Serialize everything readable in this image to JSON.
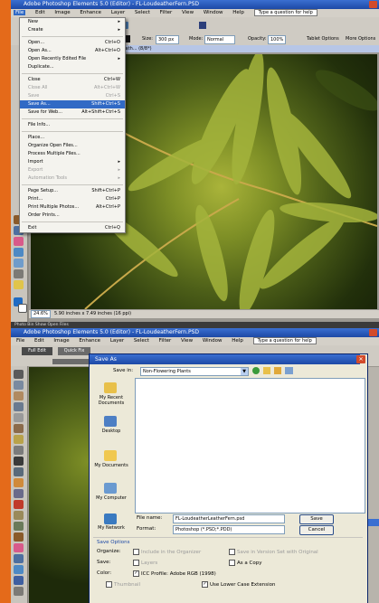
{
  "top": {
    "title": "Adobe Photoshop Elements 5.0 (Editor) - FL-LoudeatherFern.PSD",
    "menu": [
      "File",
      "Edit",
      "Image",
      "Enhance",
      "Layer",
      "Select",
      "Filter",
      "View",
      "Window",
      "Help"
    ],
    "help_box": "Type a question for help",
    "options": {
      "size_label": "Size:",
      "size_value": "300 px",
      "mode_label": "Mode:",
      "mode_value": "Normal",
      "opacity_label": "Opacity:",
      "opacity_value": "100%",
      "tablet_label": "Tablet Options",
      "more_label": "More Options"
    },
    "doc_tab": "FL-Loudeath... (8/8*)",
    "status_zoom": "24.6%",
    "status_info": "5.90 inches x 7.49 inches (16 ppi)"
  },
  "file_menu": [
    {
      "label": "New",
      "shortcut": "",
      "state": "normal",
      "arrow": true
    },
    {
      "label": "Create",
      "shortcut": "",
      "state": "normal",
      "arrow": true
    },
    {
      "sep": true
    },
    {
      "label": "Open...",
      "shortcut": "Ctrl+O",
      "state": "normal"
    },
    {
      "label": "Open As...",
      "shortcut": "Alt+Ctrl+O",
      "state": "normal"
    },
    {
      "label": "Open Recently Edited File",
      "shortcut": "",
      "state": "normal",
      "arrow": true
    },
    {
      "label": "Duplicate...",
      "shortcut": "",
      "state": "normal"
    },
    {
      "sep": true
    },
    {
      "label": "Close",
      "shortcut": "Ctrl+W",
      "state": "normal"
    },
    {
      "label": "Close All",
      "shortcut": "Alt+Ctrl+W",
      "state": "disabled"
    },
    {
      "label": "Save",
      "shortcut": "Ctrl+S",
      "state": "disabled"
    },
    {
      "label": "Save As...",
      "shortcut": "Shift+Ctrl+S",
      "state": "selected"
    },
    {
      "label": "Save for Web...",
      "shortcut": "Alt+Shift+Ctrl+S",
      "state": "normal"
    },
    {
      "sep": true
    },
    {
      "label": "File Info...",
      "shortcut": "",
      "state": "normal"
    },
    {
      "sep": true
    },
    {
      "label": "Place...",
      "shortcut": "",
      "state": "normal"
    },
    {
      "label": "Organize Open Files...",
      "shortcut": "",
      "state": "normal"
    },
    {
      "label": "Process Multiple Files...",
      "shortcut": "",
      "state": "normal"
    },
    {
      "label": "Import",
      "shortcut": "",
      "state": "normal",
      "arrow": true
    },
    {
      "label": "Export",
      "shortcut": "",
      "state": "disabled",
      "arrow": true
    },
    {
      "label": "Automation Tools",
      "shortcut": "",
      "state": "disabled",
      "arrow": true
    },
    {
      "sep": true
    },
    {
      "label": "Page Setup...",
      "shortcut": "Shift+Ctrl+P",
      "state": "normal"
    },
    {
      "label": "Print...",
      "shortcut": "Ctrl+P",
      "state": "normal"
    },
    {
      "label": "Print Multiple Photos...",
      "shortcut": "Alt+Ctrl+P",
      "state": "normal"
    },
    {
      "label": "Order Prints...",
      "shortcut": "",
      "state": "normal"
    },
    {
      "sep": true
    },
    {
      "label": "Exit",
      "shortcut": "Ctrl+Q",
      "state": "normal"
    }
  ],
  "bottom": {
    "taskbar": "Photo Bin   Show Open Files",
    "title": "Adobe Photoshop Elements 5.0 (Editor) - FL-LoudeatherFern.PSD",
    "menu": [
      "File",
      "Edit",
      "Image",
      "Enhance",
      "Layer",
      "Select",
      "Filter",
      "View",
      "Window",
      "Help"
    ],
    "help_box": "Type a question for help",
    "tab_full_edit": "Full Edit",
    "tab_quick_fix": "Quick Fix"
  },
  "save_dialog": {
    "title": "Save As",
    "save_in_label": "Save in:",
    "save_in_value": "Non-Flowering Plants",
    "places": [
      "My Recent Documents",
      "Desktop",
      "My Documents",
      "My Computer",
      "My Network"
    ],
    "file_name_label": "File name:",
    "file_name_value": "FL-LoudeatherLeatherFern.psd",
    "format_label": "Format:",
    "format_value": "Photoshop (*.PSD;*.PDD)",
    "save_button": "Save",
    "cancel_button": "Cancel",
    "options_title": "Save Options",
    "organize_label": "Organize:",
    "include_organizer": "Include in the Organizer",
    "save_version_set": "Save in Version Set with Original",
    "save_label": "Save:",
    "layers": "Layers",
    "as_copy": "As a Copy",
    "color_label": "Color:",
    "icc_profile": "ICC Profile:  Adobe RGB (1998)",
    "thumbnail": "Thumbnail",
    "lower_case": "Use Lower Case Extension"
  }
}
